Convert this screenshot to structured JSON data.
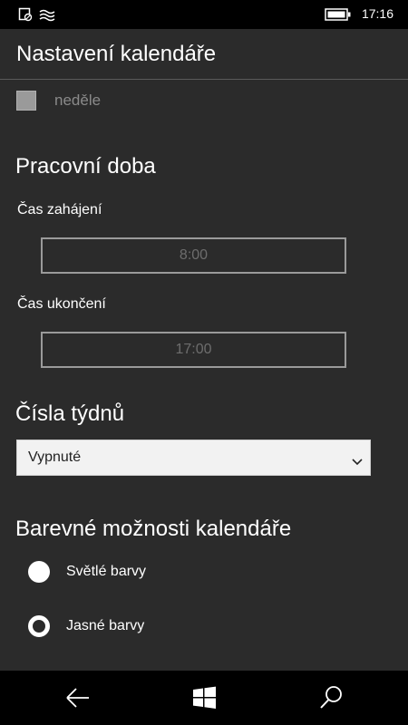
{
  "status_bar": {
    "time": "17:16",
    "icons": [
      "notification-icon",
      "wifi-icon",
      "battery-icon"
    ]
  },
  "header": {
    "title": "Nastavení kalendáře"
  },
  "first_day": {
    "checkbox_label": "neděle",
    "checked": false
  },
  "working_hours": {
    "title": "Pracovní doba",
    "start_label": "Čas zahájení",
    "start_value": "8:00",
    "end_label": "Čas ukončení",
    "end_value": "17:00"
  },
  "week_numbers": {
    "title": "Čísla týdnů",
    "selected": "Vypnuté"
  },
  "color_options": {
    "title": "Barevné možnosti kalendáře",
    "options": [
      {
        "label": "Světlé barvy",
        "selected": false
      },
      {
        "label": "Jasné barvy",
        "selected": true
      }
    ]
  },
  "nav_bar": {
    "buttons": [
      "back-icon",
      "windows-icon",
      "search-icon"
    ]
  },
  "colors": {
    "background": "#2b2b2b",
    "bars": "#000000",
    "text": "#ffffff",
    "disabled_text": "#6d6d6d"
  }
}
